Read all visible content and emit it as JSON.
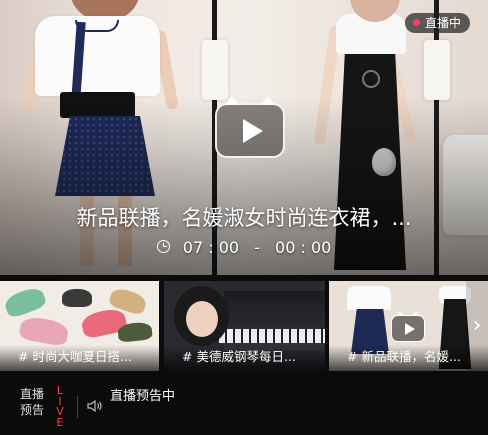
{
  "hero": {
    "title": "新品联播，名媛淑女时尚连衣裙，...",
    "time_start": "07 : 00",
    "time_sep": "-",
    "time_end": "00 : 00",
    "status_badge": "直播中"
  },
  "thumbnails": [
    {
      "caption": "# 时尚大咖夏日搭..."
    },
    {
      "caption": "# 美德威钢琴每日..."
    },
    {
      "caption": "# 新品联播，名媛..."
    }
  ],
  "bottom_bar": {
    "tag_line1": "直播",
    "tag_line2": "预告",
    "live_text": "LIVE",
    "notice": "直播预告中"
  },
  "colors": {
    "accent": "#ff3b5c",
    "background": "#0b0b0b"
  },
  "icons": [
    "play-icon",
    "clock-icon",
    "speaker-icon",
    "chevron-right-icon"
  ]
}
